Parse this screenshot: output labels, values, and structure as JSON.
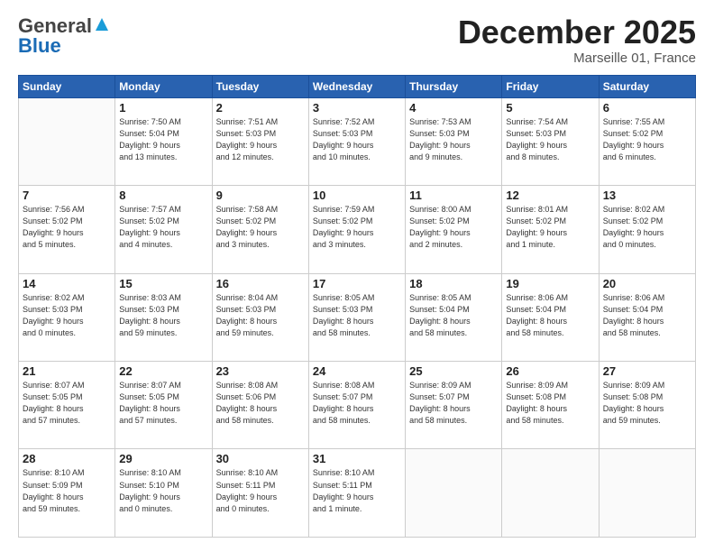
{
  "header": {
    "logo_general": "General",
    "logo_blue": "Blue",
    "month": "December 2025",
    "location": "Marseille 01, France"
  },
  "days_of_week": [
    "Sunday",
    "Monday",
    "Tuesday",
    "Wednesday",
    "Thursday",
    "Friday",
    "Saturday"
  ],
  "weeks": [
    [
      {
        "num": "",
        "info": ""
      },
      {
        "num": "1",
        "info": "Sunrise: 7:50 AM\nSunset: 5:04 PM\nDaylight: 9 hours\nand 13 minutes."
      },
      {
        "num": "2",
        "info": "Sunrise: 7:51 AM\nSunset: 5:03 PM\nDaylight: 9 hours\nand 12 minutes."
      },
      {
        "num": "3",
        "info": "Sunrise: 7:52 AM\nSunset: 5:03 PM\nDaylight: 9 hours\nand 10 minutes."
      },
      {
        "num": "4",
        "info": "Sunrise: 7:53 AM\nSunset: 5:03 PM\nDaylight: 9 hours\nand 9 minutes."
      },
      {
        "num": "5",
        "info": "Sunrise: 7:54 AM\nSunset: 5:03 PM\nDaylight: 9 hours\nand 8 minutes."
      },
      {
        "num": "6",
        "info": "Sunrise: 7:55 AM\nSunset: 5:02 PM\nDaylight: 9 hours\nand 6 minutes."
      }
    ],
    [
      {
        "num": "7",
        "info": "Sunrise: 7:56 AM\nSunset: 5:02 PM\nDaylight: 9 hours\nand 5 minutes."
      },
      {
        "num": "8",
        "info": "Sunrise: 7:57 AM\nSunset: 5:02 PM\nDaylight: 9 hours\nand 4 minutes."
      },
      {
        "num": "9",
        "info": "Sunrise: 7:58 AM\nSunset: 5:02 PM\nDaylight: 9 hours\nand 3 minutes."
      },
      {
        "num": "10",
        "info": "Sunrise: 7:59 AM\nSunset: 5:02 PM\nDaylight: 9 hours\nand 3 minutes."
      },
      {
        "num": "11",
        "info": "Sunrise: 8:00 AM\nSunset: 5:02 PM\nDaylight: 9 hours\nand 2 minutes."
      },
      {
        "num": "12",
        "info": "Sunrise: 8:01 AM\nSunset: 5:02 PM\nDaylight: 9 hours\nand 1 minute."
      },
      {
        "num": "13",
        "info": "Sunrise: 8:02 AM\nSunset: 5:02 PM\nDaylight: 9 hours\nand 0 minutes."
      }
    ],
    [
      {
        "num": "14",
        "info": "Sunrise: 8:02 AM\nSunset: 5:03 PM\nDaylight: 9 hours\nand 0 minutes."
      },
      {
        "num": "15",
        "info": "Sunrise: 8:03 AM\nSunset: 5:03 PM\nDaylight: 8 hours\nand 59 minutes."
      },
      {
        "num": "16",
        "info": "Sunrise: 8:04 AM\nSunset: 5:03 PM\nDaylight: 8 hours\nand 59 minutes."
      },
      {
        "num": "17",
        "info": "Sunrise: 8:05 AM\nSunset: 5:03 PM\nDaylight: 8 hours\nand 58 minutes."
      },
      {
        "num": "18",
        "info": "Sunrise: 8:05 AM\nSunset: 5:04 PM\nDaylight: 8 hours\nand 58 minutes."
      },
      {
        "num": "19",
        "info": "Sunrise: 8:06 AM\nSunset: 5:04 PM\nDaylight: 8 hours\nand 58 minutes."
      },
      {
        "num": "20",
        "info": "Sunrise: 8:06 AM\nSunset: 5:04 PM\nDaylight: 8 hours\nand 58 minutes."
      }
    ],
    [
      {
        "num": "21",
        "info": "Sunrise: 8:07 AM\nSunset: 5:05 PM\nDaylight: 8 hours\nand 57 minutes."
      },
      {
        "num": "22",
        "info": "Sunrise: 8:07 AM\nSunset: 5:05 PM\nDaylight: 8 hours\nand 57 minutes."
      },
      {
        "num": "23",
        "info": "Sunrise: 8:08 AM\nSunset: 5:06 PM\nDaylight: 8 hours\nand 58 minutes."
      },
      {
        "num": "24",
        "info": "Sunrise: 8:08 AM\nSunset: 5:07 PM\nDaylight: 8 hours\nand 58 minutes."
      },
      {
        "num": "25",
        "info": "Sunrise: 8:09 AM\nSunset: 5:07 PM\nDaylight: 8 hours\nand 58 minutes."
      },
      {
        "num": "26",
        "info": "Sunrise: 8:09 AM\nSunset: 5:08 PM\nDaylight: 8 hours\nand 58 minutes."
      },
      {
        "num": "27",
        "info": "Sunrise: 8:09 AM\nSunset: 5:08 PM\nDaylight: 8 hours\nand 59 minutes."
      }
    ],
    [
      {
        "num": "28",
        "info": "Sunrise: 8:10 AM\nSunset: 5:09 PM\nDaylight: 8 hours\nand 59 minutes."
      },
      {
        "num": "29",
        "info": "Sunrise: 8:10 AM\nSunset: 5:10 PM\nDaylight: 9 hours\nand 0 minutes."
      },
      {
        "num": "30",
        "info": "Sunrise: 8:10 AM\nSunset: 5:11 PM\nDaylight: 9 hours\nand 0 minutes."
      },
      {
        "num": "31",
        "info": "Sunrise: 8:10 AM\nSunset: 5:11 PM\nDaylight: 9 hours\nand 1 minute."
      },
      {
        "num": "",
        "info": ""
      },
      {
        "num": "",
        "info": ""
      },
      {
        "num": "",
        "info": ""
      }
    ]
  ]
}
